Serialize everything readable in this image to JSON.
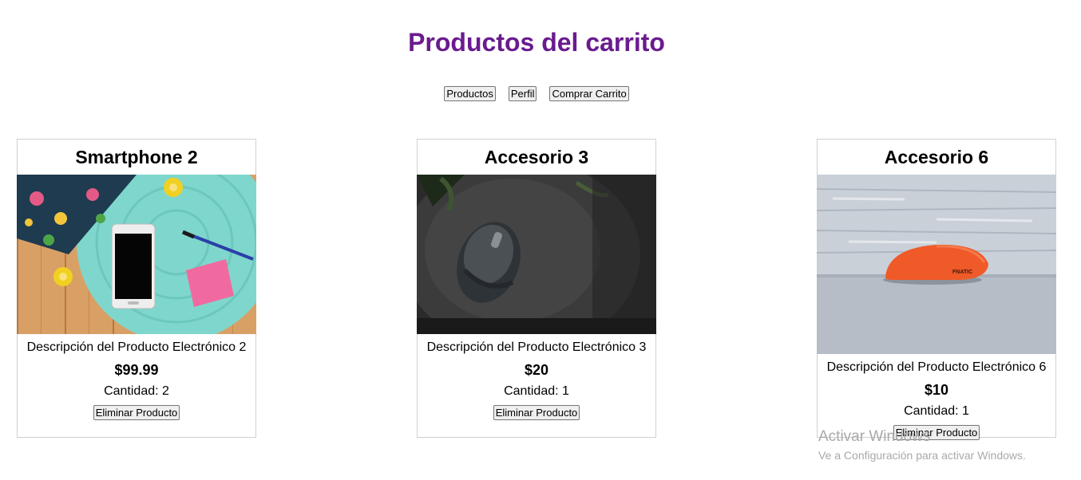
{
  "page": {
    "title": "Productos del carrito"
  },
  "nav": {
    "products_label": "Productos",
    "profile_label": "Perfil",
    "buy_cart_label": "Comprar Carrito"
  },
  "cart": {
    "items": [
      {
        "name": "Smartphone 2",
        "description": "Descripción del Producto Electrónico 2",
        "price": "$99.99",
        "quantity": "Cantidad: 2",
        "remove_label": "Eliminar Producto",
        "image_icon": "smartphone-photo"
      },
      {
        "name": "Accesorio 3",
        "description": "Descripción del Producto Electrónico 3",
        "price": "$20",
        "quantity": "Cantidad: 1",
        "remove_label": "Eliminar Producto",
        "image_icon": "mouse-photo"
      },
      {
        "name": "Accesorio 6",
        "description": "Descripción del Producto Electrónico 6",
        "price": "$10",
        "quantity": "Cantidad: 1",
        "remove_label": "Eliminar Producto",
        "image_icon": "orange-mouse-photo"
      }
    ]
  },
  "watermark": {
    "title": "Activar Windows",
    "subtitle": "Ve a Configuración para activar Windows."
  },
  "colors": {
    "title": "#6a1b8e",
    "card_border": "#d0d0d0",
    "button_bg": "#efefef",
    "button_border": "#767676",
    "watermark": "#a9a9a9"
  }
}
